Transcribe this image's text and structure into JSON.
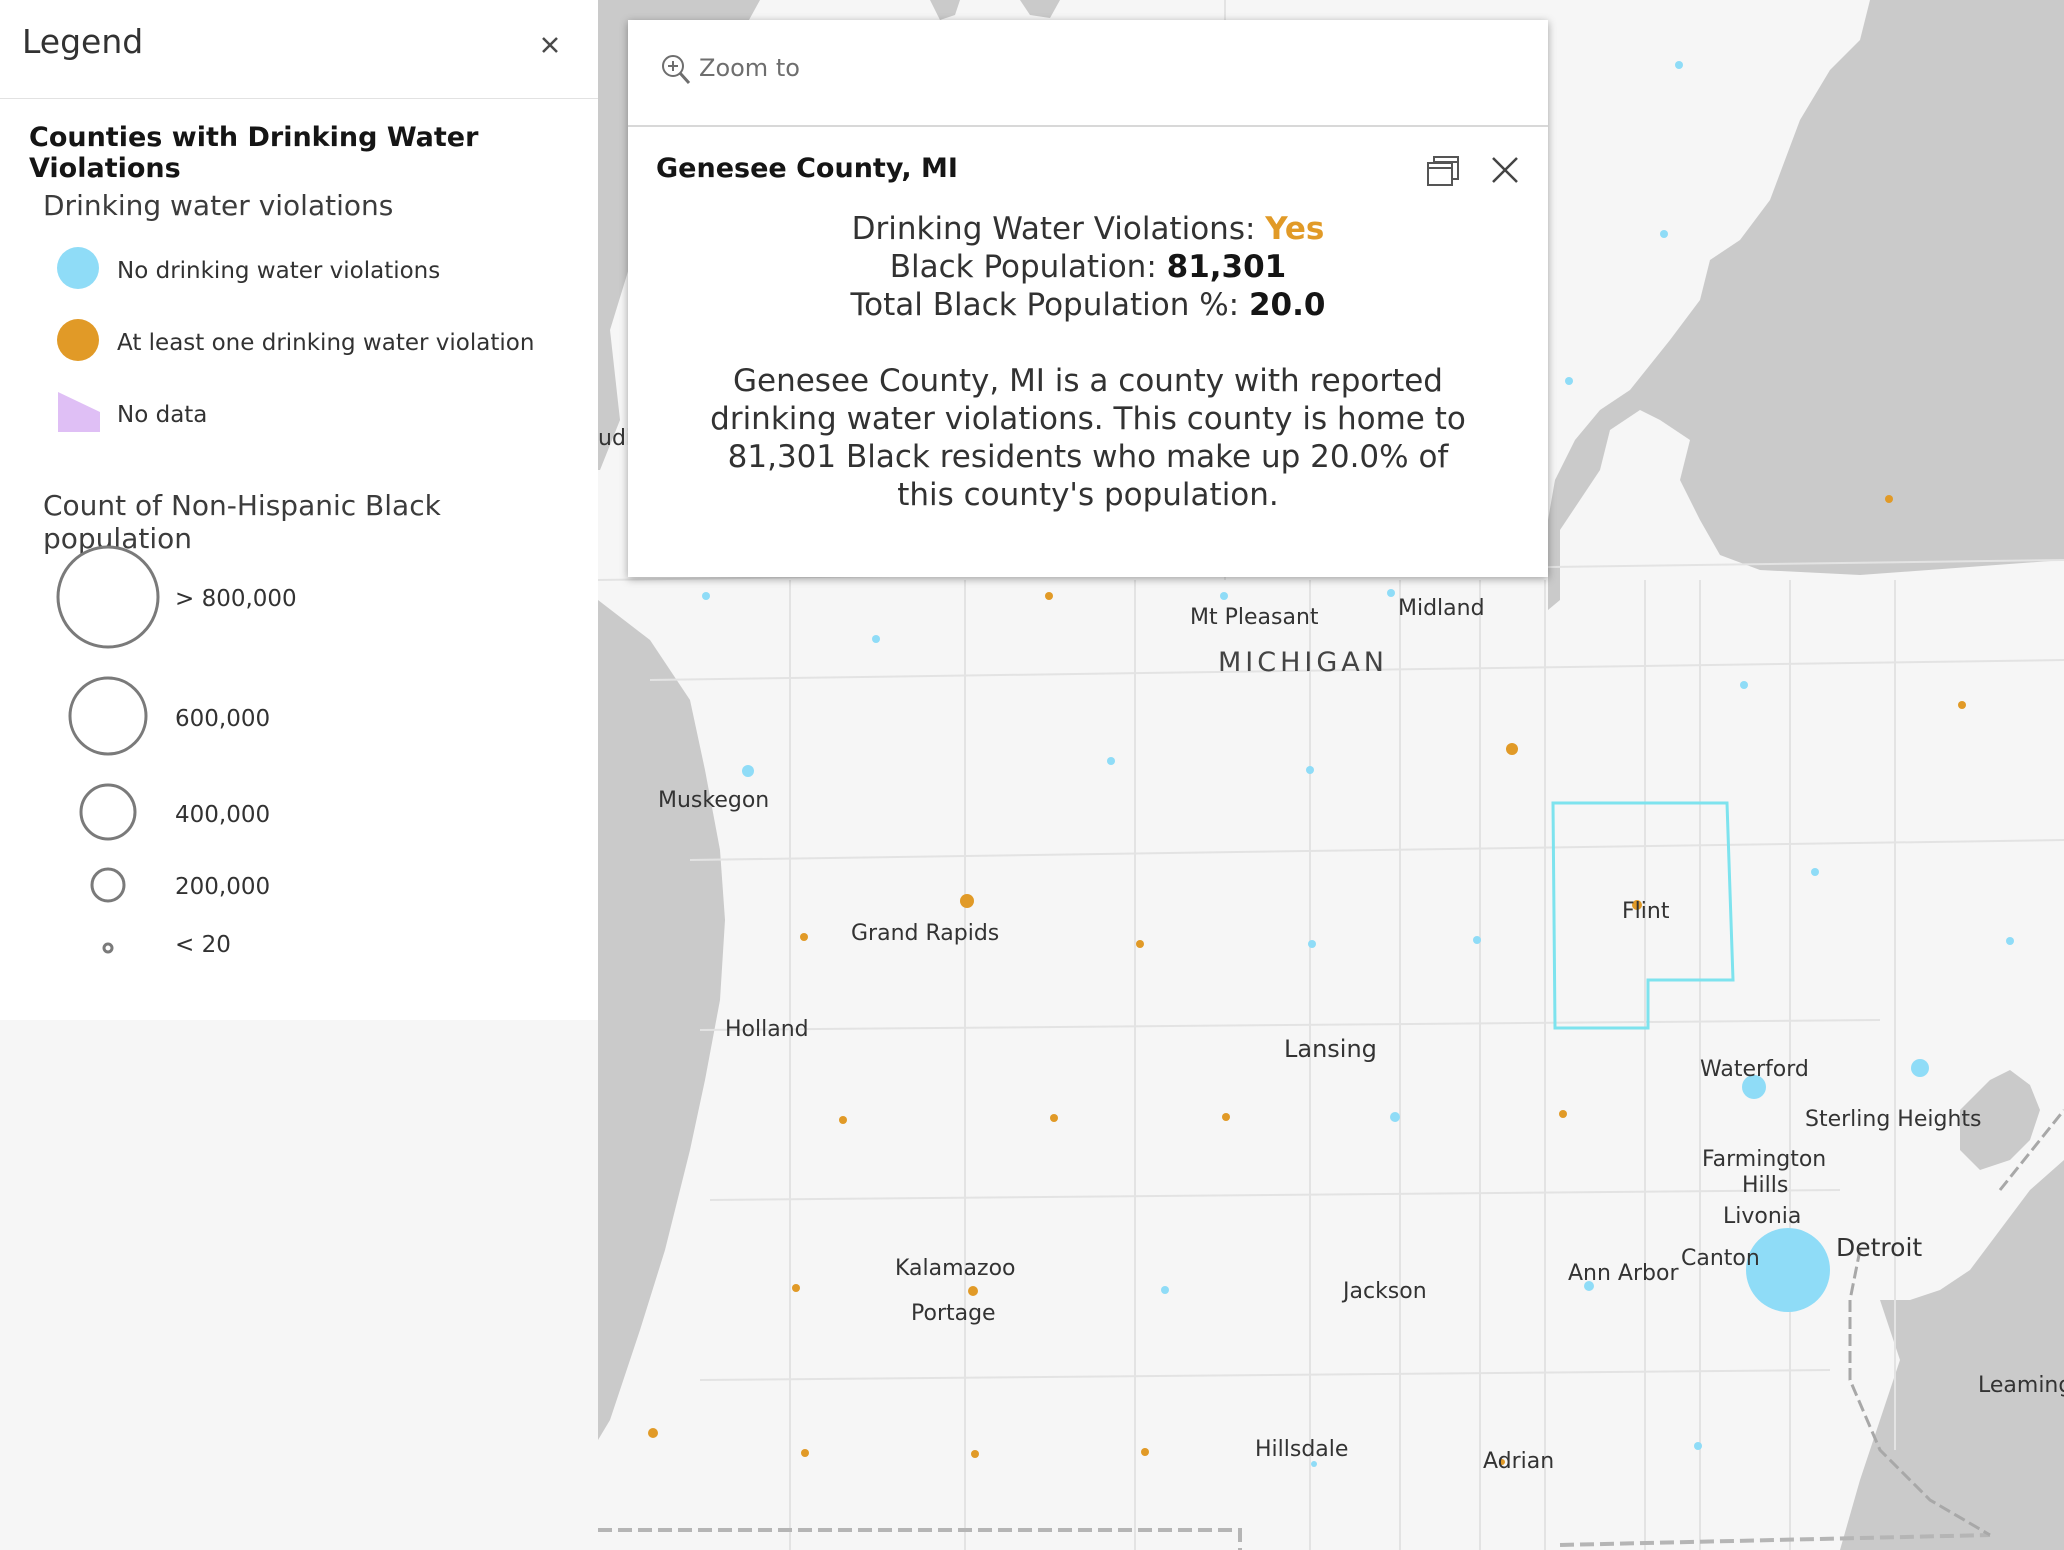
{
  "legend": {
    "title": "Legend",
    "layer_title": "Counties with Drinking Water Violations",
    "violations_section": "Drinking water violations",
    "violation_items": [
      {
        "label": "No drinking water violations",
        "color": "#8fdcf7"
      },
      {
        "label": "At least one drinking water violation",
        "color": "#e19a27"
      },
      {
        "label": "No data",
        "color": "#dfbff5"
      }
    ],
    "population_section": "Count of Non-Hispanic Black population",
    "size_items": [
      "> 800,000",
      "600,000",
      "400,000",
      "200,000",
      "< 20"
    ]
  },
  "popup": {
    "zoom_label": "Zoom to",
    "title": "Genesee County, MI",
    "violations_label": "Drinking Water Violations:",
    "violations_value": "Yes",
    "population_label": "Black Population:",
    "population_value": "81,301",
    "percent_label": "Total Black Population %:",
    "percent_value": "20.0",
    "description": "Genesee County, MI is a county with reported drinking water violations. This county is home to 81,301 Black residents who make up 20.0% of this county's population."
  },
  "map": {
    "state_label": "MICHIGAN",
    "partial_label": "udi",
    "cities": [
      "Mt Pleasant",
      "Midland",
      "Muskegon",
      "Grand Rapids",
      "Flint",
      "Holland",
      "Lansing",
      "Waterford",
      "Sterling Heights",
      "Farmington",
      "Hills",
      "Livonia",
      "Detroit",
      "Canton",
      "Ann Arbor",
      "Kalamazoo",
      "Portage",
      "Jackson",
      "Hillsdale",
      "Adrian",
      "Leaming"
    ],
    "colors": {
      "water": "#cacaca",
      "land": "#f6f6f6",
      "county_line": "#e3e3e3",
      "highlight": "#7ee3ee",
      "no_violation": "#8fdcf7",
      "violation": "#e19a27"
    }
  }
}
